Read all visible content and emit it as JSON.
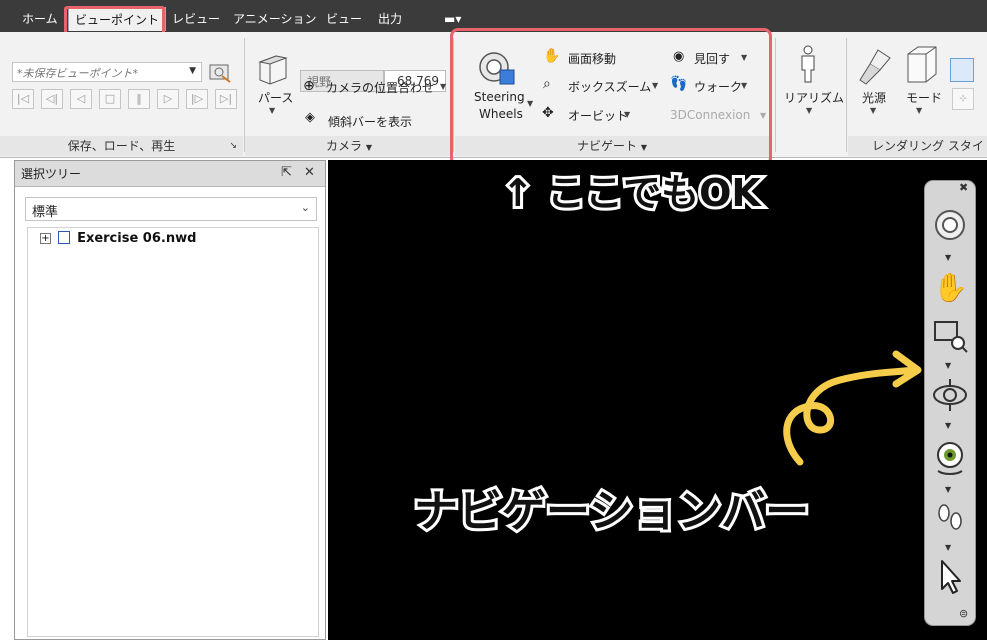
{
  "menu": {
    "tabs": [
      "ホーム",
      "ビューポイント",
      "レビュー",
      "アニメーション",
      "ビュー",
      "出力"
    ],
    "active_tab": "ビューポイント"
  },
  "ribbon": {
    "save_panel": {
      "viewpoint_select": "*未保存ビューポイント*",
      "title": "保存、ロード、再生"
    },
    "camera_panel": {
      "perspective": "パース",
      "fov_label": "視野",
      "fov_value": "68.769",
      "align_camera": "カメラの位置合わせ",
      "show_tilt_bar": "傾斜バーを表示",
      "title": "カメラ"
    },
    "navigate_panel": {
      "steering_line1": "Steering",
      "steering_line2": "Wheels",
      "pan": "画面移動",
      "zoom_box": "ボックスズーム",
      "orbit": "オービット",
      "look_around": "見回す",
      "walk": "ウォーク",
      "connexion": "3DConnexion",
      "title": "ナビゲート"
    },
    "realism": "リアリズム",
    "light": "光源",
    "mode": "モード",
    "render_title": "レンダリング スタイ"
  },
  "tree": {
    "title": "選択ツリー",
    "select_value": "標準",
    "file_node": "Exercise 06.nwd"
  },
  "annotations": {
    "here_ok": "↑ ここでもOK",
    "navbar_label": "ナビゲーションバー"
  },
  "colors": {
    "highlight": "#e8636b",
    "arrow": "#f6cd4a",
    "viewport_bg": "#000000"
  }
}
